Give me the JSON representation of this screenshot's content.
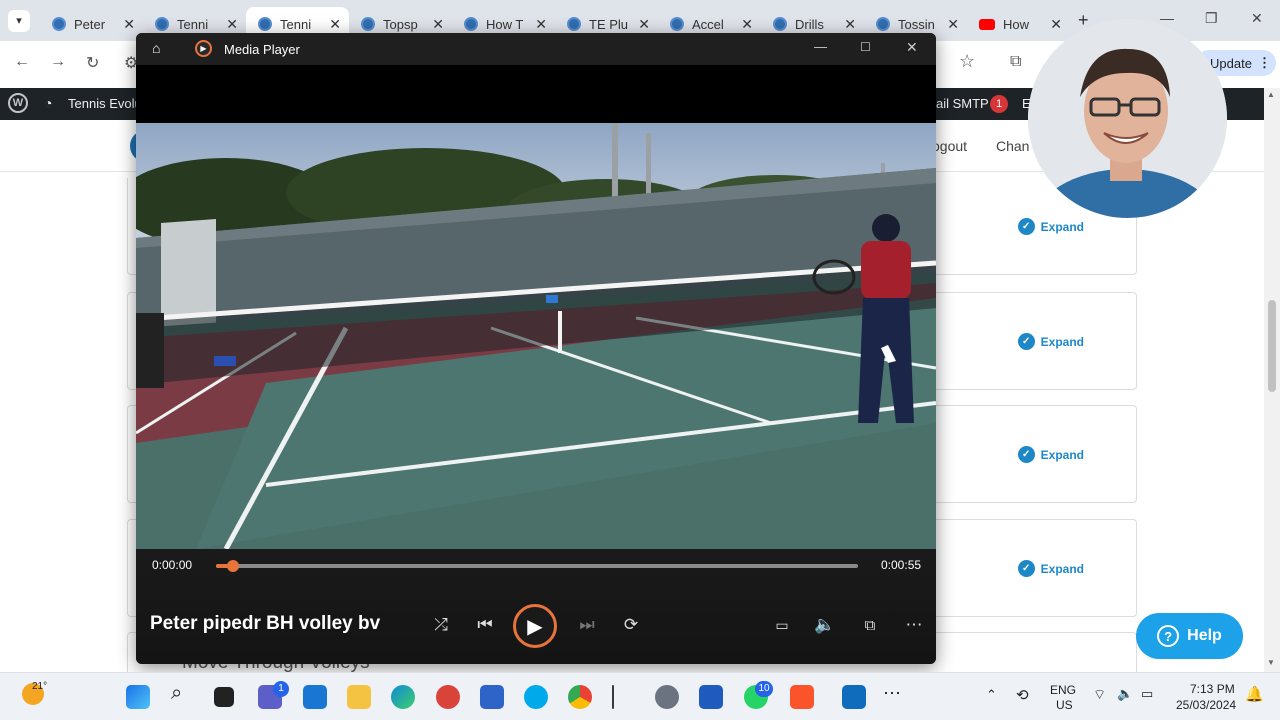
{
  "browser": {
    "tabs": [
      {
        "label": "Peter",
        "active": false
      },
      {
        "label": "Tenni",
        "active": false
      },
      {
        "label": "Tenni",
        "active": true
      },
      {
        "label": "Topsp",
        "active": false
      },
      {
        "label": "How T",
        "active": false
      },
      {
        "label": "TE Plu",
        "active": false
      },
      {
        "label": "Accel",
        "active": false
      },
      {
        "label": "Drills",
        "active": false
      },
      {
        "label": "Tossin",
        "active": false
      },
      {
        "label": "How",
        "active": false
      }
    ],
    "update_label": "Update"
  },
  "wp_admin_bar": {
    "site_name": "Tennis Evolu",
    "smtp_label": "ail SMTP",
    "smtp_badge": "1",
    "trailing": "E"
  },
  "site_header": {
    "logout": "ogout",
    "change": "Chan"
  },
  "lessons": {
    "expand_label": "Expand",
    "bottom_title": "Move Through Volleys"
  },
  "help_label": "Help",
  "media_player": {
    "window_title": "Media Player",
    "current_time": "0:00:00",
    "duration": "0:00:55",
    "progress": 0.02,
    "video_title": "Peter pipedr BH volley bv"
  },
  "taskbar": {
    "weather_temp": "21°",
    "teams_badge": "1",
    "whatsapp_badge": "10",
    "lang_top": "ENG",
    "lang_bottom": "US",
    "clock_time": "7:13 PM",
    "clock_date": "25/03/2024"
  },
  "colors": {
    "accent_orange": "#e8743b",
    "expand_blue": "#1e88c7",
    "help_blue": "#1da1e8"
  }
}
